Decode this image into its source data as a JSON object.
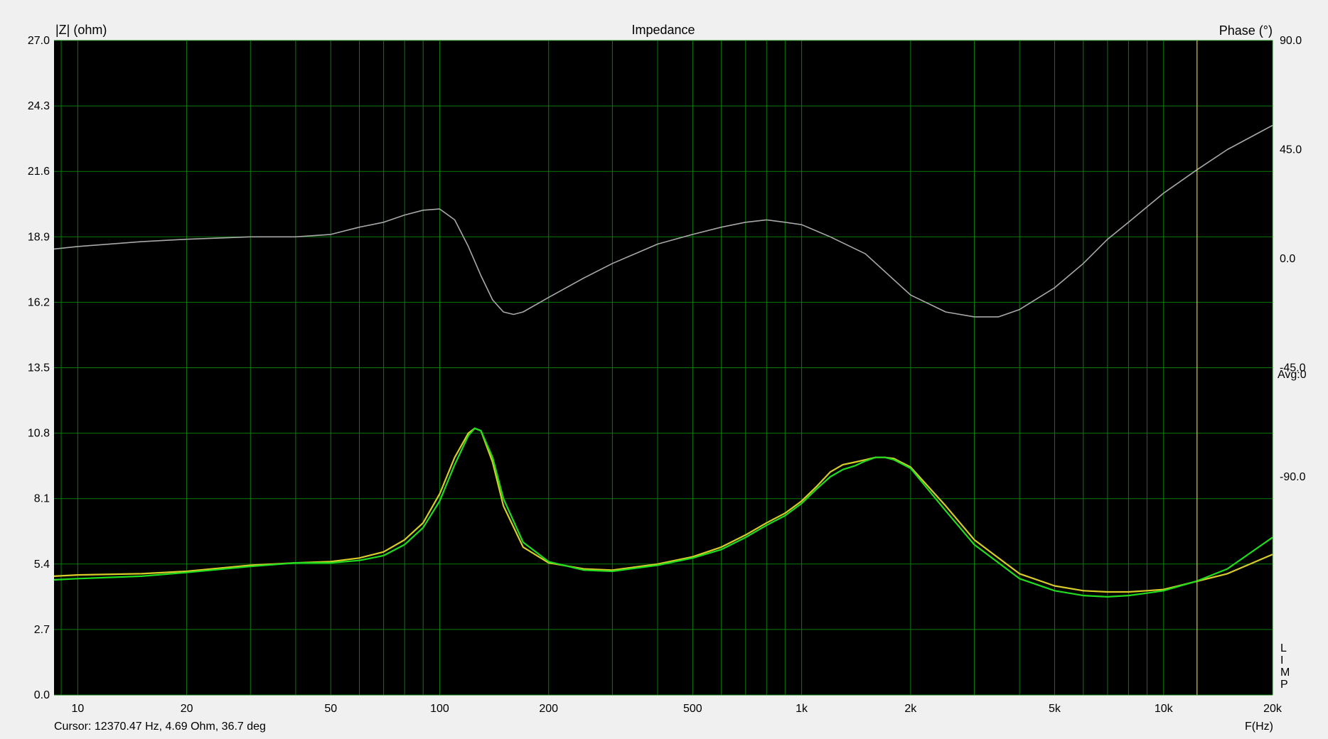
{
  "chart_data": {
    "type": "line",
    "title": "Impedance",
    "ylabel_left": "|Z| (ohm)",
    "ylabel_right": "Phase (°)",
    "xlabel": "F(Hz)",
    "x_scale": "log",
    "xlim": [
      8.6,
      20000
    ],
    "ylim_left": [
      0.0,
      27.0
    ],
    "ylim_right": [
      -180,
      90
    ],
    "grid": true,
    "background": "#000000",
    "grid_color": "#0b7a0b",
    "x_ticks": [
      {
        "value": 10,
        "label": "10"
      },
      {
        "value": 20,
        "label": "20"
      },
      {
        "value": 50,
        "label": "50"
      },
      {
        "value": 100,
        "label": "100"
      },
      {
        "value": 200,
        "label": "200"
      },
      {
        "value": 500,
        "label": "500"
      },
      {
        "value": 1000,
        "label": "1k"
      },
      {
        "value": 2000,
        "label": "2k"
      },
      {
        "value": 5000,
        "label": "5k"
      },
      {
        "value": 10000,
        "label": "10k"
      },
      {
        "value": 20000,
        "label": "20k"
      }
    ],
    "y_ticks_left": [
      {
        "value": 27.0,
        "label": "27.0"
      },
      {
        "value": 24.3,
        "label": "24.3"
      },
      {
        "value": 21.6,
        "label": "21.6"
      },
      {
        "value": 18.9,
        "label": "18.9"
      },
      {
        "value": 16.2,
        "label": "16.2"
      },
      {
        "value": 13.5,
        "label": "13.5"
      },
      {
        "value": 10.8,
        "label": "10.8"
      },
      {
        "value": 8.1,
        "label": "8.1"
      },
      {
        "value": 5.4,
        "label": "5.4"
      },
      {
        "value": 2.7,
        "label": "2.7"
      },
      {
        "value": 0.0,
        "label": "0.0"
      }
    ],
    "y_ticks_right": [
      {
        "value": 90,
        "label": "90.0"
      },
      {
        "value": 45,
        "label": "45.0"
      },
      {
        "value": 0,
        "label": "0.0"
      },
      {
        "value": -45,
        "label": "-45.0"
      },
      {
        "value": -90,
        "label": "-90.0"
      }
    ],
    "series": [
      {
        "axis": "left",
        "color": "#d8cc28",
        "x": [
          8.6,
          10,
          15,
          20,
          30,
          40,
          50,
          60,
          70,
          80,
          90,
          100,
          110,
          120,
          125,
          130,
          140,
          150,
          170,
          200,
          250,
          300,
          400,
          500,
          600,
          700,
          800,
          900,
          1000,
          1100,
          1200,
          1300,
          1400,
          1500,
          1600,
          1700,
          1800,
          2000,
          2500,
          3000,
          4000,
          5000,
          6000,
          7000,
          8000,
          9000,
          10000,
          12370,
          15000,
          20000
        ],
        "y": [
          4.9,
          4.95,
          5.0,
          5.1,
          5.35,
          5.45,
          5.5,
          5.65,
          5.9,
          6.4,
          7.1,
          8.3,
          9.8,
          10.8,
          11.0,
          10.9,
          9.6,
          7.8,
          6.1,
          5.45,
          5.2,
          5.15,
          5.4,
          5.7,
          6.1,
          6.6,
          7.1,
          7.5,
          8.0,
          8.6,
          9.2,
          9.5,
          9.6,
          9.7,
          9.8,
          9.8,
          9.75,
          9.4,
          7.8,
          6.4,
          5.0,
          4.5,
          4.3,
          4.25,
          4.25,
          4.3,
          4.35,
          4.69,
          5.0,
          5.8
        ]
      },
      {
        "axis": "left",
        "color": "#1fdc1f",
        "x": [
          8.6,
          10,
          15,
          20,
          30,
          40,
          50,
          60,
          70,
          80,
          90,
          100,
          110,
          120,
          125,
          130,
          140,
          150,
          170,
          200,
          250,
          300,
          400,
          500,
          600,
          700,
          800,
          900,
          1000,
          1100,
          1200,
          1300,
          1400,
          1500,
          1600,
          1700,
          1800,
          2000,
          2500,
          3000,
          4000,
          5000,
          6000,
          7000,
          8000,
          9000,
          10000,
          12370,
          15000,
          20000
        ],
        "y": [
          4.75,
          4.8,
          4.9,
          5.05,
          5.3,
          5.45,
          5.45,
          5.55,
          5.75,
          6.2,
          6.9,
          8.0,
          9.5,
          10.7,
          11.0,
          10.9,
          9.8,
          8.1,
          6.3,
          5.5,
          5.15,
          5.1,
          5.35,
          5.65,
          6.0,
          6.5,
          7.0,
          7.4,
          7.9,
          8.5,
          9.0,
          9.3,
          9.45,
          9.65,
          9.8,
          9.8,
          9.7,
          9.35,
          7.6,
          6.2,
          4.8,
          4.3,
          4.1,
          4.05,
          4.1,
          4.2,
          4.3,
          4.7,
          5.2,
          6.5
        ]
      },
      {
        "axis": "right",
        "color": "#a8a8a8",
        "x": [
          8.6,
          10,
          15,
          20,
          30,
          40,
          50,
          60,
          70,
          80,
          90,
          100,
          110,
          120,
          130,
          140,
          150,
          160,
          170,
          200,
          250,
          300,
          400,
          500,
          600,
          700,
          800,
          900,
          1000,
          1200,
          1500,
          2000,
          2500,
          3000,
          3500,
          4000,
          5000,
          6000,
          7000,
          8000,
          10000,
          12370,
          15000,
          20000
        ],
        "y": [
          4,
          5,
          7,
          8,
          9,
          9,
          10,
          13,
          15,
          18,
          20,
          20.5,
          16,
          5,
          -7,
          -17,
          -22,
          -23,
          -22,
          -16,
          -8,
          -2,
          6,
          10,
          13,
          15,
          16,
          15,
          14,
          9,
          2,
          -15,
          -22,
          -24,
          -24,
          -21,
          -12,
          -2,
          8,
          15,
          27,
          36.7,
          45,
          55
        ]
      }
    ],
    "cursor": {
      "x": 12370.47,
      "color": "#e6c81e"
    },
    "cursor_text": "Cursor: 12370.47 Hz, 4.69 Ohm, 36.7 deg",
    "avg_label": "Avg:0",
    "side_letters": [
      "L",
      "I",
      "M",
      "P"
    ]
  }
}
